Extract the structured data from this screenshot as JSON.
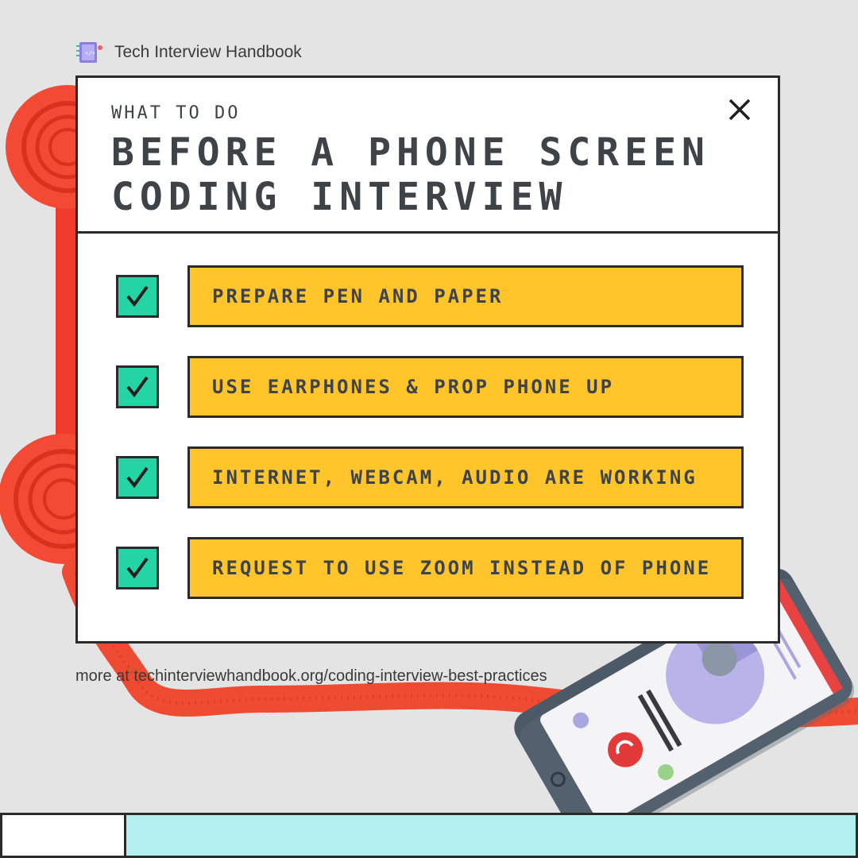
{
  "brand": {
    "name": "Tech Interview Handbook",
    "logo_icon": "notebook-icon"
  },
  "card": {
    "eyebrow": "WHAT TO DO",
    "title": "Before a phone screen coding interview",
    "close_icon": "close-icon",
    "items": [
      {
        "label": "PREPARE PEN AND PAPER",
        "checked": true
      },
      {
        "label": "USE EARPHONES & PROP PHONE UP",
        "checked": true
      },
      {
        "label": "INTERNET, WEBCAM, AUDIO ARE WORKING",
        "checked": true
      },
      {
        "label": "REQUEST TO USE ZOOM INSTEAD OF PHONE",
        "checked": true
      }
    ]
  },
  "footer": {
    "more_text": "more at techinterviewhandbook.org/coding-interview-best-practices"
  },
  "colors": {
    "check_bg": "#25d4a4",
    "pill_bg": "#ffc52a",
    "text_dark": "#3e4347",
    "phone_red": "#f2452f",
    "bottom_bar": "#b3efef"
  }
}
